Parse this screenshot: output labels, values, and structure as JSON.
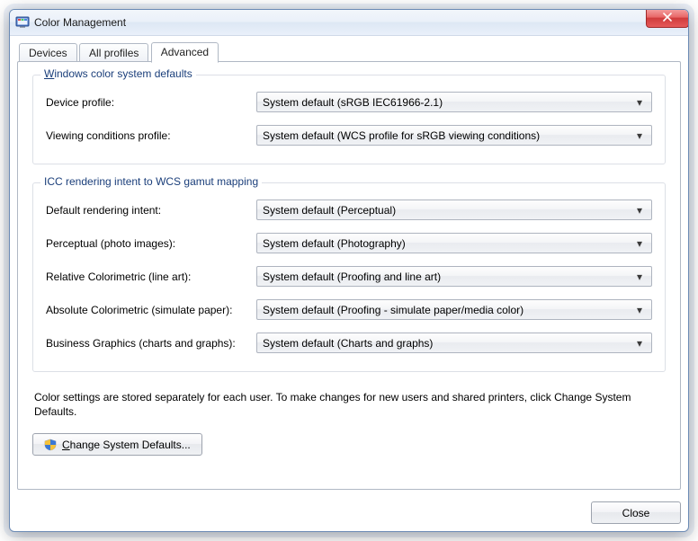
{
  "window": {
    "title": "Color Management"
  },
  "tabs": {
    "devices": "Devices",
    "all_profiles": "All profiles",
    "advanced": "Advanced"
  },
  "group": {
    "wcs_title_wrest": "indows color system defaults",
    "icc_title": "ICC  rendering intent to WCS gamut mapping"
  },
  "labels": {
    "device_profile": "Device profile:",
    "viewing_conditions": "Viewing conditions profile:",
    "default_rendering": "Default rendering intent:",
    "perceptual": "Perceptual (photo images):",
    "relative": "Relative Colorimetric (line art):",
    "absolute": "Absolute Colorimetric (simulate paper):",
    "business": "Business Graphics (charts and graphs):"
  },
  "values": {
    "device_profile": "System default (sRGB IEC61966-2.1)",
    "viewing_conditions": "System default (WCS profile for sRGB viewing conditions)",
    "default_rendering": "System default (Perceptual)",
    "perceptual": "System default (Photography)",
    "relative": "System default (Proofing and line art)",
    "absolute": "System default (Proofing - simulate paper/media color)",
    "business": "System default (Charts and graphs)"
  },
  "info": "Color settings are stored separately for each user. To make changes for new users and shared printers, click Change System Defaults.",
  "buttons": {
    "change_defaults_rest": "hange System Defaults...",
    "close": "Close"
  }
}
